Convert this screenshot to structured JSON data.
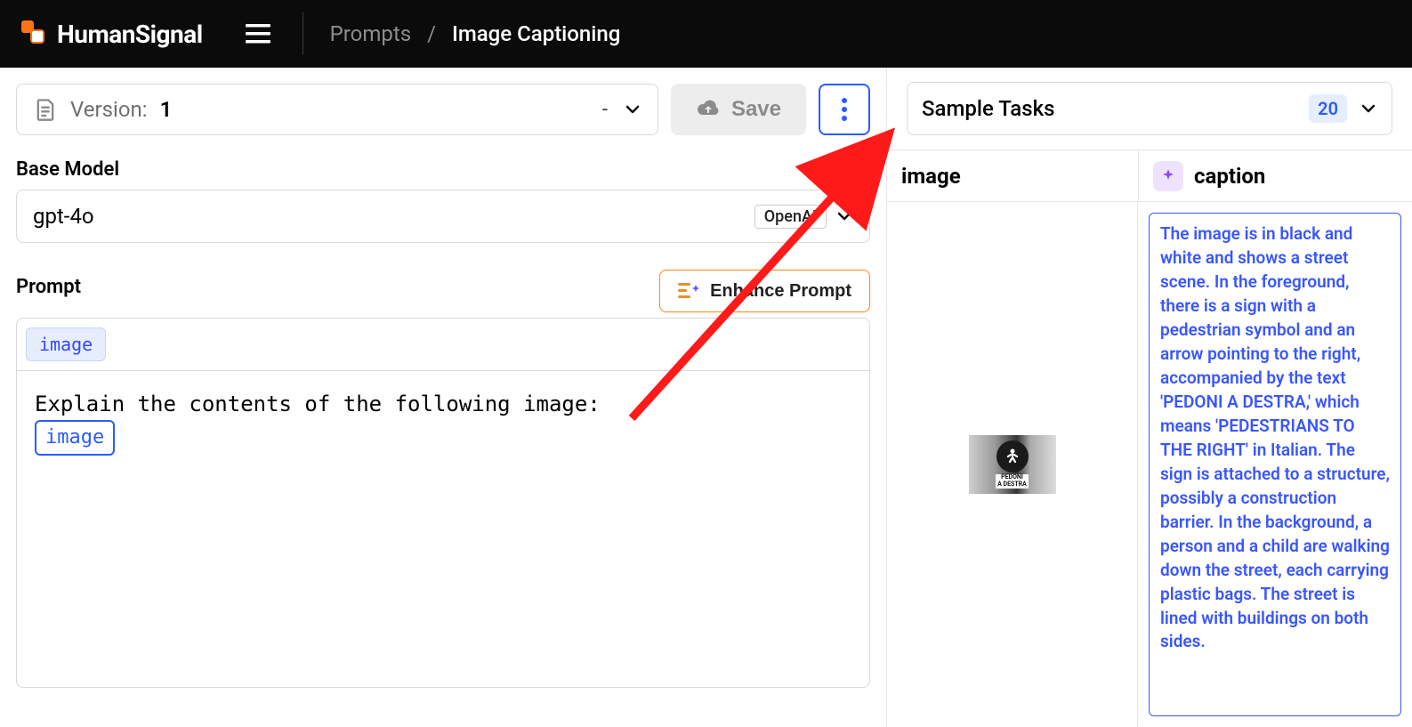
{
  "header": {
    "brand": "HumanSignal",
    "breadcrumb_root": "Prompts",
    "breadcrumb_sep": "/",
    "breadcrumb_current": "Image Captioning"
  },
  "toolbar": {
    "version_label": "Version:",
    "version_number": "1",
    "version_dash": "-",
    "save_label": "Save"
  },
  "base_model": {
    "section_label": "Base Model",
    "model_name": "gpt-4o",
    "provider": "OpenAI"
  },
  "prompt": {
    "section_label": "Prompt",
    "enhance_label": "Enhance Prompt",
    "chip_label": "image",
    "text": "Explain the contents of the following image:",
    "var_chip": "image"
  },
  "sample_tasks": {
    "label": "Sample Tasks",
    "count": "20",
    "col_image": "image",
    "col_caption": "caption",
    "caption_text": "The image is in black and white and shows a street scene. In the foreground, there is a sign with a pedestrian symbol and an arrow pointing to the right, accompanied by the text 'PEDONI A DESTRA,' which means 'PEDESTRIANS TO THE RIGHT' in Italian. The sign is attached to a structure, possibly a construction barrier. In the background, a person and a child are walking down the street, each carrying plastic bags. The street is lined with buildings on both sides.",
    "thumb_line1": "PEDONI",
    "thumb_line2": "A DESTRA"
  }
}
